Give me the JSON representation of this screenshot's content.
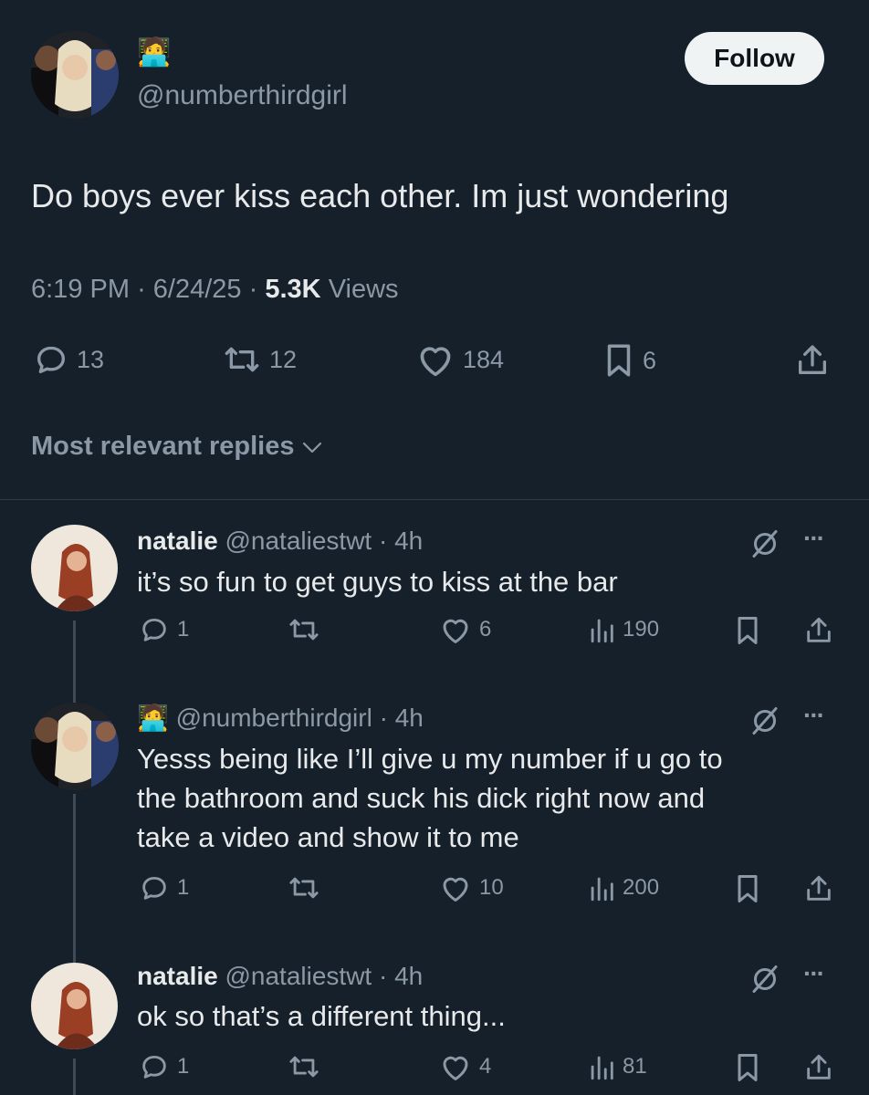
{
  "tweet": {
    "handle": "@numberthirdgirl",
    "emoji": "🧑‍💻",
    "follow_label": "Follow",
    "text": "Do boys ever kiss each other. Im just wondering",
    "time": "6:19 PM",
    "date": "6/24/25",
    "views_count": "5.3K",
    "views_label": "Views",
    "sep": "·",
    "stats": {
      "replies": "13",
      "retweets": "12",
      "likes": "184",
      "bookmarks": "6"
    },
    "sort_label": "Most relevant replies"
  },
  "replies": [
    {
      "name": "natalie",
      "handle": "@nataliestwt",
      "time": "4h",
      "text_lines": [
        "it’s so fun to get guys to kiss at the bar"
      ],
      "replies": "1",
      "retweets": "",
      "likes": "6",
      "views": "190"
    },
    {
      "name": "",
      "emoji": "🧑‍💻",
      "handle": "@numberthirdgirl",
      "time": "4h",
      "text_lines": [
        "Yesss being like I’ll give u my number if u go to",
        "the bathroom and suck his dick right now and",
        "take a video and show it to me"
      ],
      "replies": "1",
      "retweets": "",
      "likes": "10",
      "views": "200"
    },
    {
      "name": "natalie",
      "handle": "@nataliestwt",
      "time": "4h",
      "text_lines": [
        "ok so that’s a different thing..."
      ],
      "replies": "1",
      "retweets": "",
      "likes": "4",
      "views": "81"
    }
  ]
}
